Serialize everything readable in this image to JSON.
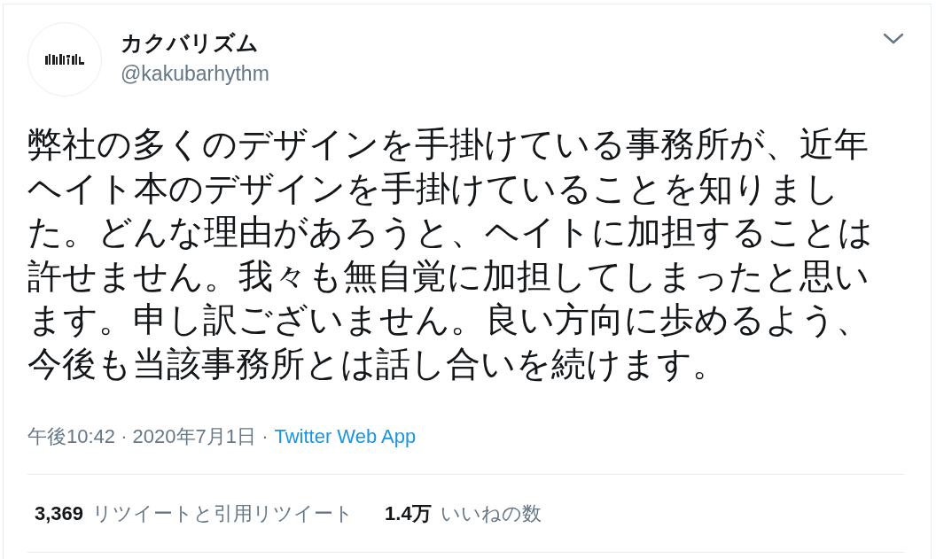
{
  "tweet": {
    "author": {
      "name": "カクバリズム",
      "handle": "@kakubarhythm"
    },
    "text": "弊社の多くのデザインを手掛けている事務所が、近年ヘイト本のデザインを手掛けていることを知りました。どんな理由があろうと、ヘイトに加担することは許せません。我々も無自覚に加担してしまったと思います。申し訳ございません。良い方向に歩めるよう、今後も当該事務所とは話し合いを続けます。",
    "meta": "午後10:42 · 2020年7月1日 ·",
    "source": "Twitter Web App",
    "stats": [
      {
        "count": "3,369",
        "label": "リツイートと引用リツイート"
      },
      {
        "count": "1.4万",
        "label": "いいねの数"
      }
    ]
  }
}
